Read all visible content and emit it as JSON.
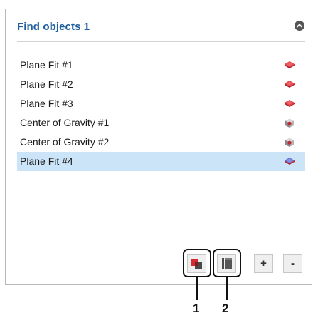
{
  "panel": {
    "title": "Find objects 1"
  },
  "items": [
    {
      "label": "Plane Fit #1",
      "icon": "plane-fit-icon",
      "color": "#e0303a",
      "selected": false
    },
    {
      "label": "Plane Fit #2",
      "icon": "plane-fit-icon",
      "color": "#e0303a",
      "selected": false
    },
    {
      "label": "Plane Fit #3",
      "icon": "plane-fit-icon",
      "color": "#e0303a",
      "selected": false
    },
    {
      "label": "Center of Gravity #1",
      "icon": "center-of-gravity-icon",
      "color": "#c0282f",
      "selected": false
    },
    {
      "label": "Center of Gravity #2",
      "icon": "center-of-gravity-icon",
      "color": "#c0282f",
      "selected": false
    },
    {
      "label": "Plane Fit #4",
      "icon": "plane-fit-icon",
      "color": "#5860c8",
      "selected": true
    }
  ],
  "toolbar": {
    "add_label": "+",
    "remove_label": "-"
  },
  "callouts": {
    "one": "1",
    "two": "2"
  },
  "colors": {
    "title": "#1f5f9f",
    "selection": "#cce4f7",
    "accent_red": "#e0303a"
  }
}
